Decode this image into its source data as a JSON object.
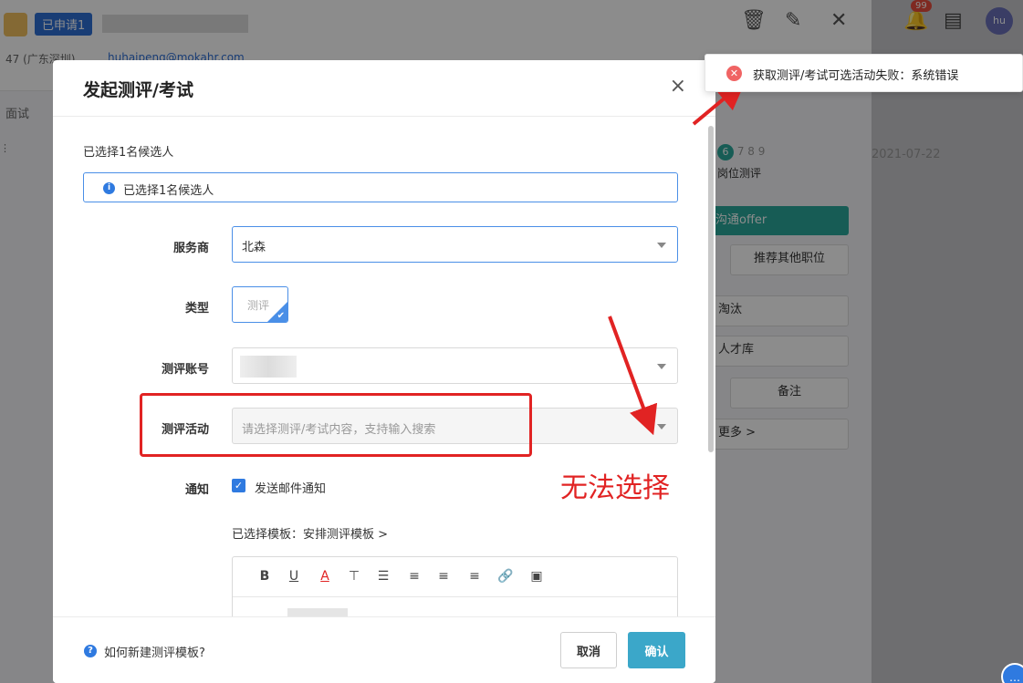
{
  "background": {
    "status_tag": "已申请1",
    "location_meta": "47 (广东深圳)",
    "email": "huhaipeng@mokahr.com",
    "tab_label": "面试",
    "step_current": "6",
    "steps_rest": "7  8  9",
    "step_label": "岗位测评",
    "date": "2021-07-22",
    "offer_button": "沟通offer",
    "recommend_button": "推荐其他职位",
    "eliminate_button": "淘汰",
    "talent_pool_button": "人才库",
    "note_button": "备注",
    "more_button": "更多 >",
    "notification_count": "99",
    "profile_initials": "hu"
  },
  "modal": {
    "title": "发起测评/考试",
    "close": "×",
    "selected_count": "已选择1名候选人",
    "info_text": "已选择1名候选人",
    "labels": {
      "provider": "服务商",
      "type": "类型",
      "account": "测评账号",
      "activity": "测评活动",
      "notify": "通知"
    },
    "provider_value": "北森",
    "type_option": "测评",
    "activity_placeholder": "请选择测评/考试内容，支持输入搜索",
    "notify_checkbox_label": "发送邮件通知",
    "template_link": "已选择模板：安排测评模板 >",
    "editor_toolbar": [
      "B",
      "U",
      "A",
      "⊤",
      "☰",
      "≡",
      "≡",
      "≡",
      "🔗",
      "▣"
    ],
    "help_text": "如何新建测评模板?",
    "cancel_label": "取消",
    "confirm_label": "确认"
  },
  "toast": {
    "icon": "✕",
    "message": "获取测评/考试可选活动失败：系统错误"
  },
  "annotation": {
    "text": "无法选择",
    "color": "#e12323"
  }
}
